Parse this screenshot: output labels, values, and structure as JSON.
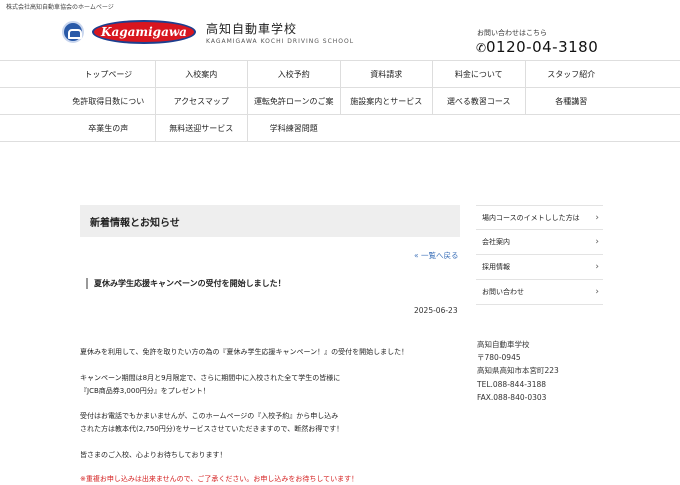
{
  "header": {
    "tagline": "株式会社高知自動車協会のホームページ",
    "logo_text": "Kagamigawa",
    "school_name": "高知自動車学校",
    "school_name_en": "KAGAMIGAWA KOCHI DRIVING SCHOOL",
    "contact_label": "お問い合わせはこちら",
    "phone": "0120-04-3180"
  },
  "nav": {
    "row1": [
      "トップページ",
      "入校案内",
      "入校予約",
      "資料請求",
      "料金について",
      "スタッフ紹介"
    ],
    "row2": [
      "免許取得日数につい",
      "アクセスマップ",
      "運転免許ローンのご案",
      "施設案内とサービス",
      "選べる教習コース",
      "各種講習"
    ],
    "row3": [
      "卒業生の声",
      "無料送迎サービス",
      "学科練習問題"
    ]
  },
  "main": {
    "section_title": "新着情報とお知らせ",
    "back_link": "« 一覧へ戻る",
    "article_title": "夏休み学生応援キャンペーンの受付を開始しました！",
    "article_date": "2025-06-23",
    "paragraphs": [
      "夏休みを利用して、免許を取りたい方の為の『夏休み学生応援キャンペーン！』の受付を開始しました！",
      "キャンペーン期間は8月と9月限定で、さらに期間中に入校された全て学生の皆様に",
      "『JCB商品券3,000円分』をプレゼント！",
      "受付はお電話でもかまいませんが、このホームページの『入校予約』から申し込み",
      "された方は教本代(2,750円分)をサービスさせていただきますので、断然お得です！",
      "皆さまのご入校、心よりお待ちしております！",
      "※重複お申し込みは出来ませんので、ご了承ください。お申し込みをお待ちしています！"
    ]
  },
  "sidebar": {
    "items": [
      "場内コースのイメトしした方は",
      "会社案内",
      "採用情報",
      "お問い合わせ"
    ],
    "address": {
      "name": "高知自動車学校",
      "postal": "〒780-0945",
      "street": "高知県高知市本宮町223",
      "tel": "TEL.088-844-3188",
      "fax": "FAX.088-840-0303"
    }
  }
}
